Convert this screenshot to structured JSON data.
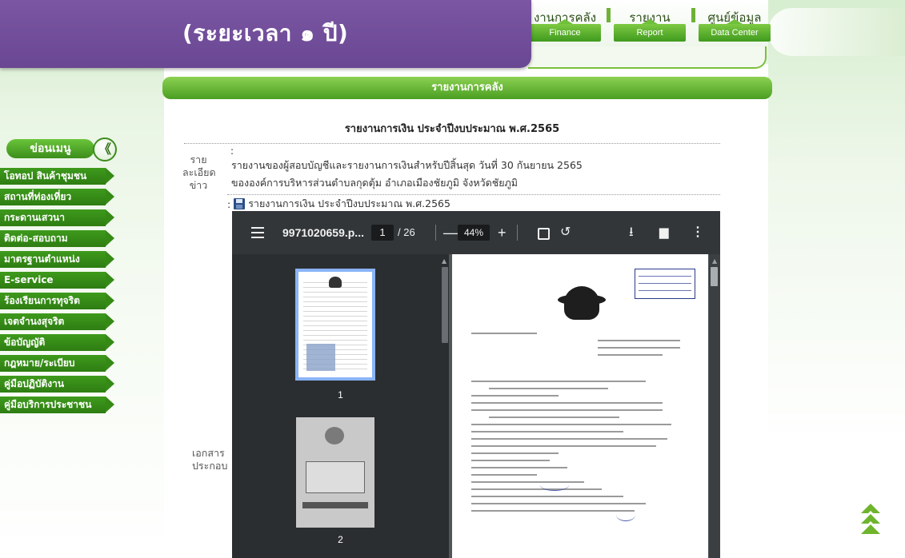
{
  "banner": {
    "text": "(ระยะเวลา ๑ ปี)"
  },
  "nav": [
    {
      "th": "งานการคลัง",
      "en": "Finance"
    },
    {
      "th": "รายงาน",
      "en": "Report"
    },
    {
      "th": "ศูนย์ข้อมูล",
      "en": "Data Center"
    }
  ],
  "section_title": "รายงานการคลัง",
  "sidebar": {
    "header": "ข่อนเมนู",
    "back_icon": "double-chevron-left-icon",
    "items": [
      "โอทอป สินค้าชุมชน",
      "สถานที่ท่องเที่ยว",
      "กระดานเสวนา",
      "ติดต่อ-สอบถาม",
      "มาตรฐานตำแหน่ง",
      "E-service",
      "ร้องเรียนการทุจริต",
      "เจตจำนงสุจริต",
      "ข้อบัญญัติ",
      "กฎหมาย/ระเบียบ",
      "คู่มือปฏิบัติงาน",
      "คู่มือบริการประชาชน"
    ]
  },
  "report": {
    "heading": "รายงานการเงิน ประจำปีงบประมาณ พ.ศ.2565",
    "detail_label_1": "ราย",
    "detail_label_2": "ละเอียด",
    "detail_label_3": "ข่าว",
    "colon": ":",
    "detail_line_1": "รายงานของผู้สอบบัญชีและรายงานการเงินสำหรับปีสิ้นสุด วันที่ 30 กันยายน 2565",
    "detail_line_2": "ขององค์การบริหารส่วนตำบลกุดตุ้ม อำเภอเมืองชัยภูมิ จังหวัดชัยภูมิ",
    "attachment_prefix": ":",
    "attachment_title": "รายงานการเงิน ประจำปีงบประมาณ พ.ศ.2565",
    "attach_label_1": "เอกสาร",
    "attach_label_2": "ประกอบ"
  },
  "pdf_viewer": {
    "file_name": "9971020659.p...",
    "current_page": "1",
    "total_pages": "/ 26",
    "zoom": "44%",
    "minus": "—",
    "plus": "+",
    "thumbs": [
      "1",
      "2"
    ],
    "icons": [
      "menu-icon",
      "fit-page-icon",
      "rotate-icon",
      "download-icon",
      "print-icon",
      "more-icon"
    ]
  },
  "colors": {
    "banner": "#6a4793",
    "accent_green": "#3e9a1c",
    "pdf_toolbar": "#323639"
  }
}
